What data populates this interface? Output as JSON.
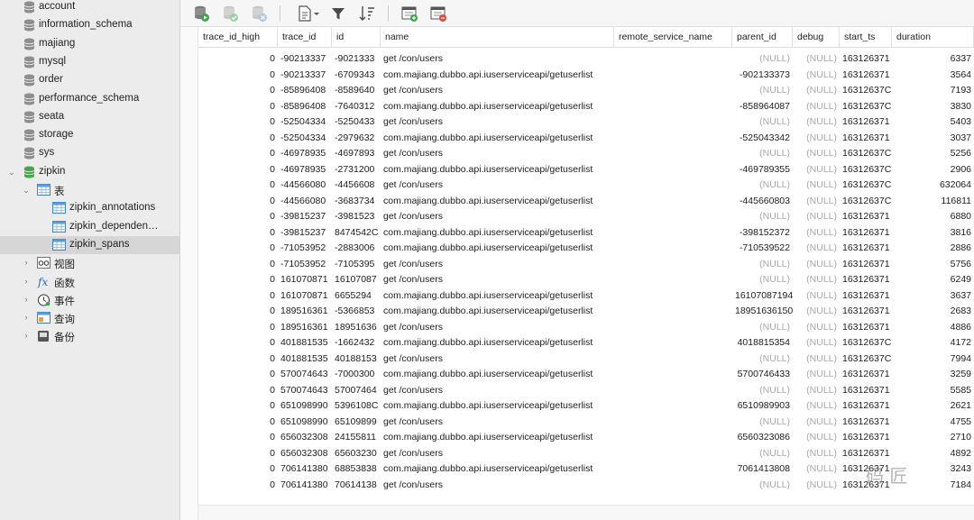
{
  "sidebar": {
    "databases": [
      {
        "label": "account"
      },
      {
        "label": "information_schema"
      },
      {
        "label": "majiang"
      },
      {
        "label": "mysql"
      },
      {
        "label": "order"
      },
      {
        "label": "performance_schema"
      },
      {
        "label": "seata"
      },
      {
        "label": "storage"
      },
      {
        "label": "sys"
      },
      {
        "label": "zipkin"
      }
    ],
    "tables_group": "表",
    "tables": [
      {
        "label": "zipkin_annotations"
      },
      {
        "label": "zipkin_dependen…"
      },
      {
        "label": "zipkin_spans"
      }
    ],
    "groups": [
      {
        "label": "视图",
        "icon": "views-icon"
      },
      {
        "label": "函数",
        "icon": "function-icon"
      },
      {
        "label": "事件",
        "icon": "event-clock-icon"
      },
      {
        "label": "查询",
        "icon": "query-icon"
      },
      {
        "label": "备份",
        "icon": "backup-icon"
      }
    ]
  },
  "toolbar": {
    "icons": [
      "run-query-icon",
      "commit-icon",
      "rollback-icon",
      "export-icon",
      "filter-icon",
      "sort-icon",
      "import-icon",
      "import-export-icon"
    ]
  },
  "columns": [
    "trace_id_high",
    "trace_id",
    "id",
    "name",
    "remote_service_name",
    "parent_id",
    "debug",
    "start_ts",
    "duration"
  ],
  "rows": [
    [
      "0",
      "-90213337",
      "-9021333",
      "get /con/users",
      "",
      "(NULL)",
      "(NULL)",
      "163126371",
      "6337"
    ],
    [
      "0",
      "-90213337",
      "-6709343",
      "com.majiang.dubbo.api.iuserserviceapi/getuserlist",
      "",
      "-902133373",
      "(NULL)",
      "163126371",
      "3564"
    ],
    [
      "0",
      "-85896408",
      "-8589640",
      "get /con/users",
      "",
      "(NULL)",
      "(NULL)",
      "16312637C",
      "7193"
    ],
    [
      "0",
      "-85896408",
      "-7640312",
      "com.majiang.dubbo.api.iuserserviceapi/getuserlist",
      "",
      "-858964087",
      "(NULL)",
      "16312637C",
      "3830"
    ],
    [
      "0",
      "-52504334",
      "-5250433",
      "get /con/users",
      "",
      "(NULL)",
      "(NULL)",
      "163126371",
      "5403"
    ],
    [
      "0",
      "-52504334",
      "-2979632",
      "com.majiang.dubbo.api.iuserserviceapi/getuserlist",
      "",
      "-525043342",
      "(NULL)",
      "163126371",
      "3037"
    ],
    [
      "0",
      "-46978935",
      "-4697893",
      "get /con/users",
      "",
      "(NULL)",
      "(NULL)",
      "16312637C",
      "5256"
    ],
    [
      "0",
      "-46978935",
      "-2731200",
      "com.majiang.dubbo.api.iuserserviceapi/getuserlist",
      "",
      "-469789355",
      "(NULL)",
      "16312637C",
      "2906"
    ],
    [
      "0",
      "-44566080",
      "-4456608",
      "get /con/users",
      "",
      "(NULL)",
      "(NULL)",
      "16312637C",
      "632064"
    ],
    [
      "0",
      "-44566080",
      "-3683734",
      "com.majiang.dubbo.api.iuserserviceapi/getuserlist",
      "",
      "-445660803",
      "(NULL)",
      "16312637C",
      "116811"
    ],
    [
      "0",
      "-39815237",
      "-3981523",
      "get /con/users",
      "",
      "(NULL)",
      "(NULL)",
      "163126371",
      "6880"
    ],
    [
      "0",
      "-39815237",
      "8474542C",
      "com.majiang.dubbo.api.iuserserviceapi/getuserlist",
      "",
      "-398152372",
      "(NULL)",
      "163126371",
      "3816"
    ],
    [
      "0",
      "-71053952",
      "-2883006",
      "com.majiang.dubbo.api.iuserserviceapi/getuserlist",
      "",
      "-710539522",
      "(NULL)",
      "163126371",
      "2886"
    ],
    [
      "0",
      "-71053952",
      "-7105395",
      "get /con/users",
      "",
      "(NULL)",
      "(NULL)",
      "163126371",
      "5756"
    ],
    [
      "0",
      "161070871",
      "16107087",
      "get /con/users",
      "",
      "(NULL)",
      "(NULL)",
      "163126371",
      "6249"
    ],
    [
      "0",
      "161070871",
      "6655294",
      "com.majiang.dubbo.api.iuserserviceapi/getuserlist",
      "",
      "16107087194",
      "(NULL)",
      "163126371",
      "3637"
    ],
    [
      "0",
      "189516361",
      "-5366853",
      "com.majiang.dubbo.api.iuserserviceapi/getuserlist",
      "",
      "18951636150",
      "(NULL)",
      "163126371",
      "2683"
    ],
    [
      "0",
      "189516361",
      "18951636",
      "get /con/users",
      "",
      "(NULL)",
      "(NULL)",
      "163126371",
      "4886"
    ],
    [
      "0",
      "401881535",
      "-1662432",
      "com.majiang.dubbo.api.iuserserviceapi/getuserlist",
      "",
      "4018815354",
      "(NULL)",
      "16312637C",
      "4172"
    ],
    [
      "0",
      "401881535",
      "40188153",
      "get /con/users",
      "",
      "(NULL)",
      "(NULL)",
      "16312637C",
      "7994"
    ],
    [
      "0",
      "570074643",
      "-7000300",
      "com.majiang.dubbo.api.iuserserviceapi/getuserlist",
      "",
      "5700746433",
      "(NULL)",
      "163126371",
      "3259"
    ],
    [
      "0",
      "570074643",
      "57007464",
      "get /con/users",
      "",
      "(NULL)",
      "(NULL)",
      "163126371",
      "5585"
    ],
    [
      "0",
      "651098990",
      "5396108C",
      "com.majiang.dubbo.api.iuserserviceapi/getuserlist",
      "",
      "6510989903",
      "(NULL)",
      "163126371",
      "2621"
    ],
    [
      "0",
      "651098990",
      "65109899",
      "get /con/users",
      "",
      "(NULL)",
      "(NULL)",
      "163126371",
      "4755"
    ],
    [
      "0",
      "656032308",
      "24155811",
      "com.majiang.dubbo.api.iuserserviceapi/getuserlist",
      "",
      "6560323086",
      "(NULL)",
      "163126371",
      "2710"
    ],
    [
      "0",
      "656032308",
      "65603230",
      "get /con/users",
      "",
      "(NULL)",
      "(NULL)",
      "163126371",
      "4892"
    ],
    [
      "0",
      "706141380",
      "68853838",
      "com.majiang.dubbo.api.iuserserviceapi/getuserlist",
      "",
      "7061413808",
      "(NULL)",
      "163126371",
      "3243"
    ],
    [
      "0",
      "706141380",
      "70614138",
      "get /con/users",
      "",
      "(NULL)",
      "(NULL)",
      "163126371",
      "7184"
    ]
  ],
  "watermark": "码 匠"
}
